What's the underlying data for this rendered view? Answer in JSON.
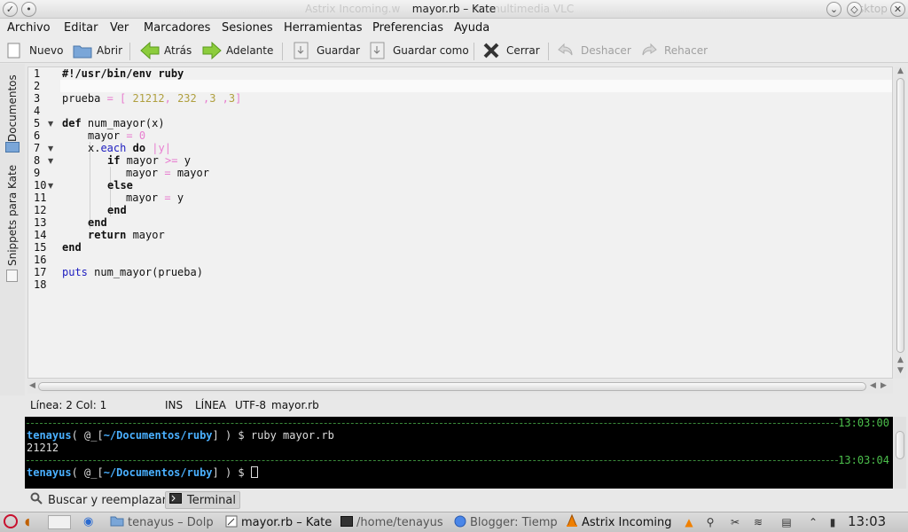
{
  "window": {
    "title": "mayor.rb – Kate",
    "ghost_left": "Astrix Incoming.w",
    "ghost_right": "or multimedia VLC",
    "ghost_far": "sktop"
  },
  "menu": [
    "Archivo",
    "Editar",
    "Ver",
    "Marcadores",
    "Sesiones",
    "Herramientas",
    "Preferencias",
    "Ayuda"
  ],
  "toolbar": {
    "new": "Nuevo",
    "open": "Abrir",
    "back": "Atrás",
    "forward": "Adelante",
    "save": "Guardar",
    "save_as": "Guardar como",
    "close": "Cerrar",
    "undo": "Deshacer",
    "redo": "Rehacer"
  },
  "sidebar": {
    "documents": "Documentos",
    "snippets": "Snippets para Kate"
  },
  "editor": {
    "line_numbers": [
      "1",
      "2",
      "3",
      "4",
      "5",
      "6",
      "7",
      "8",
      "9",
      "10",
      "11",
      "12",
      "13",
      "14",
      "15",
      "16",
      "17",
      "18"
    ],
    "shebang": "#!/usr/bin/env ruby",
    "prueba_var": "prueba",
    "prueba_eq": " = [ ",
    "prueba_n1": "21212",
    "prueba_c1": ", ",
    "prueba_n2": "232",
    "prueba_c2": " ,",
    "prueba_n3": "3",
    "prueba_c3": " ,",
    "prueba_n4": "3",
    "prueba_close": "]",
    "def_kw": "def",
    "def_rest": " num_mayor(x)",
    "mayor_var": "mayor",
    "mayor_eq": " = ",
    "mayor_zero": "0",
    "each_recv": "x.",
    "each_meth": "each",
    "each_do": "do",
    "each_block": " |y|",
    "if_kw": "if",
    "if_a": " mayor ",
    "if_op": ">=",
    "if_b": " y",
    "assign1_a": "mayor",
    "assign1_eq": " = ",
    "assign1_b": "mayor",
    "else_kw": "else",
    "assign2_a": "mayor",
    "assign2_eq": " = ",
    "assign2_b": "y",
    "end_kw": "end",
    "return_kw": "return",
    "return_rest": " mayor",
    "puts_kw": "puts",
    "puts_rest": " num_mayor(prueba)"
  },
  "status": {
    "position": "Línea: 2 Col: 1",
    "mode": "INS",
    "line_label": "LÍNEA",
    "encoding": "UTF-8",
    "filename": "mayor.rb"
  },
  "terminal": {
    "time1": "13:03:00",
    "user": "tenayus",
    "prompt_mid": "( @_[",
    "path": "~/Documentos/ruby",
    "prompt_end": "] ) $ ",
    "command": "ruby mayor.rb",
    "output": "21212",
    "time2": "13:03:04"
  },
  "bottom_tabs": {
    "search": "Buscar y reemplazar",
    "terminal": "Terminal"
  },
  "taskbar": {
    "tasks": [
      "tenayus – Dolp",
      "mayor.rb – Kate",
      "/home/tenayus",
      "Blogger: Tiemp",
      "Astrix Incoming"
    ],
    "clock": "13:03"
  },
  "colors": {
    "accent_green": "#4cbf4c",
    "term_blue": "#4ab0ff",
    "string_num": "#b0a040",
    "operator_pink": "#e87ed0"
  }
}
